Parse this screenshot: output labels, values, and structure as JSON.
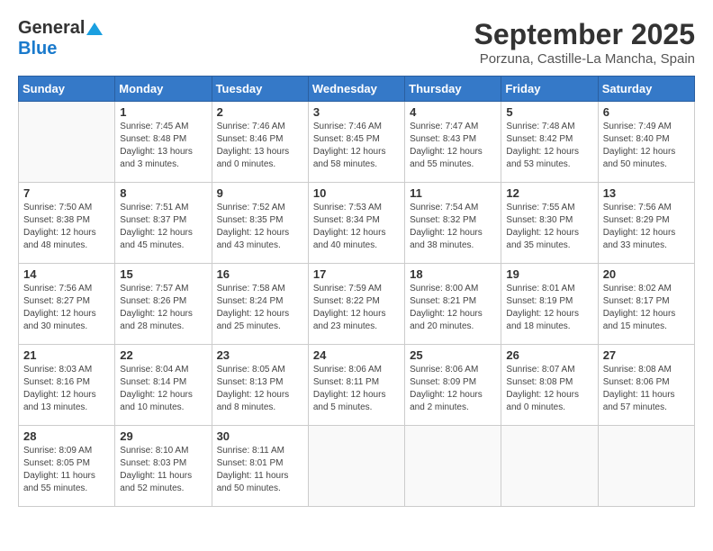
{
  "header": {
    "logo_general": "General",
    "logo_blue": "Blue",
    "title": "September 2025",
    "subtitle": "Porzuna, Castille-La Mancha, Spain"
  },
  "weekdays": [
    "Sunday",
    "Monday",
    "Tuesday",
    "Wednesday",
    "Thursday",
    "Friday",
    "Saturday"
  ],
  "weeks": [
    [
      {
        "num": "",
        "info": ""
      },
      {
        "num": "1",
        "info": "Sunrise: 7:45 AM\nSunset: 8:48 PM\nDaylight: 13 hours\nand 3 minutes."
      },
      {
        "num": "2",
        "info": "Sunrise: 7:46 AM\nSunset: 8:46 PM\nDaylight: 13 hours\nand 0 minutes."
      },
      {
        "num": "3",
        "info": "Sunrise: 7:46 AM\nSunset: 8:45 PM\nDaylight: 12 hours\nand 58 minutes."
      },
      {
        "num": "4",
        "info": "Sunrise: 7:47 AM\nSunset: 8:43 PM\nDaylight: 12 hours\nand 55 minutes."
      },
      {
        "num": "5",
        "info": "Sunrise: 7:48 AM\nSunset: 8:42 PM\nDaylight: 12 hours\nand 53 minutes."
      },
      {
        "num": "6",
        "info": "Sunrise: 7:49 AM\nSunset: 8:40 PM\nDaylight: 12 hours\nand 50 minutes."
      }
    ],
    [
      {
        "num": "7",
        "info": "Sunrise: 7:50 AM\nSunset: 8:38 PM\nDaylight: 12 hours\nand 48 minutes."
      },
      {
        "num": "8",
        "info": "Sunrise: 7:51 AM\nSunset: 8:37 PM\nDaylight: 12 hours\nand 45 minutes."
      },
      {
        "num": "9",
        "info": "Sunrise: 7:52 AM\nSunset: 8:35 PM\nDaylight: 12 hours\nand 43 minutes."
      },
      {
        "num": "10",
        "info": "Sunrise: 7:53 AM\nSunset: 8:34 PM\nDaylight: 12 hours\nand 40 minutes."
      },
      {
        "num": "11",
        "info": "Sunrise: 7:54 AM\nSunset: 8:32 PM\nDaylight: 12 hours\nand 38 minutes."
      },
      {
        "num": "12",
        "info": "Sunrise: 7:55 AM\nSunset: 8:30 PM\nDaylight: 12 hours\nand 35 minutes."
      },
      {
        "num": "13",
        "info": "Sunrise: 7:56 AM\nSunset: 8:29 PM\nDaylight: 12 hours\nand 33 minutes."
      }
    ],
    [
      {
        "num": "14",
        "info": "Sunrise: 7:56 AM\nSunset: 8:27 PM\nDaylight: 12 hours\nand 30 minutes."
      },
      {
        "num": "15",
        "info": "Sunrise: 7:57 AM\nSunset: 8:26 PM\nDaylight: 12 hours\nand 28 minutes."
      },
      {
        "num": "16",
        "info": "Sunrise: 7:58 AM\nSunset: 8:24 PM\nDaylight: 12 hours\nand 25 minutes."
      },
      {
        "num": "17",
        "info": "Sunrise: 7:59 AM\nSunset: 8:22 PM\nDaylight: 12 hours\nand 23 minutes."
      },
      {
        "num": "18",
        "info": "Sunrise: 8:00 AM\nSunset: 8:21 PM\nDaylight: 12 hours\nand 20 minutes."
      },
      {
        "num": "19",
        "info": "Sunrise: 8:01 AM\nSunset: 8:19 PM\nDaylight: 12 hours\nand 18 minutes."
      },
      {
        "num": "20",
        "info": "Sunrise: 8:02 AM\nSunset: 8:17 PM\nDaylight: 12 hours\nand 15 minutes."
      }
    ],
    [
      {
        "num": "21",
        "info": "Sunrise: 8:03 AM\nSunset: 8:16 PM\nDaylight: 12 hours\nand 13 minutes."
      },
      {
        "num": "22",
        "info": "Sunrise: 8:04 AM\nSunset: 8:14 PM\nDaylight: 12 hours\nand 10 minutes."
      },
      {
        "num": "23",
        "info": "Sunrise: 8:05 AM\nSunset: 8:13 PM\nDaylight: 12 hours\nand 8 minutes."
      },
      {
        "num": "24",
        "info": "Sunrise: 8:06 AM\nSunset: 8:11 PM\nDaylight: 12 hours\nand 5 minutes."
      },
      {
        "num": "25",
        "info": "Sunrise: 8:06 AM\nSunset: 8:09 PM\nDaylight: 12 hours\nand 2 minutes."
      },
      {
        "num": "26",
        "info": "Sunrise: 8:07 AM\nSunset: 8:08 PM\nDaylight: 12 hours\nand 0 minutes."
      },
      {
        "num": "27",
        "info": "Sunrise: 8:08 AM\nSunset: 8:06 PM\nDaylight: 11 hours\nand 57 minutes."
      }
    ],
    [
      {
        "num": "28",
        "info": "Sunrise: 8:09 AM\nSunset: 8:05 PM\nDaylight: 11 hours\nand 55 minutes."
      },
      {
        "num": "29",
        "info": "Sunrise: 8:10 AM\nSunset: 8:03 PM\nDaylight: 11 hours\nand 52 minutes."
      },
      {
        "num": "30",
        "info": "Sunrise: 8:11 AM\nSunset: 8:01 PM\nDaylight: 11 hours\nand 50 minutes."
      },
      {
        "num": "",
        "info": ""
      },
      {
        "num": "",
        "info": ""
      },
      {
        "num": "",
        "info": ""
      },
      {
        "num": "",
        "info": ""
      }
    ]
  ]
}
